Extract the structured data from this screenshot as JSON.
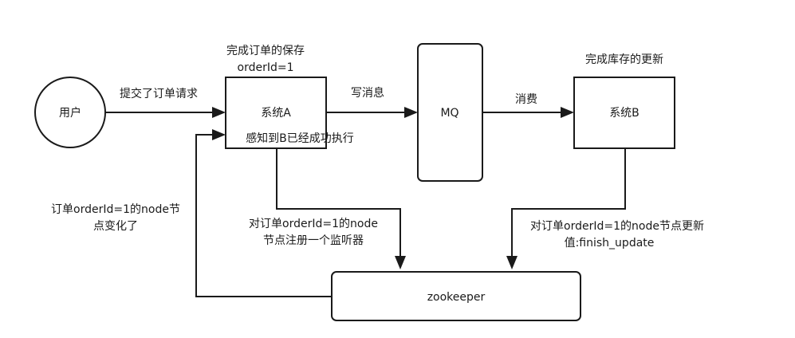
{
  "nodes": {
    "user": "用户",
    "system_a": "系统A",
    "mq": "MQ",
    "system_b": "系统B",
    "zookeeper": "zookeeper"
  },
  "labels": {
    "submit_order": "提交了订单请求",
    "save_order_line1": "完成订单的保存",
    "save_order_line2": "orderId=1",
    "write_message": "写消息",
    "consume": "消费",
    "inventory_done": "完成库存的更新",
    "sensed_b_done": "感知到B已经成功执行",
    "node_changed_line1": "订单orderId=1的node节",
    "node_changed_line2": "点变化了",
    "register_listener_line1": "对订单orderId=1的node",
    "register_listener_line2": "节点注册一个监听器",
    "update_node_line1": "对订单orderId=1的node节点更新",
    "update_node_line2": "值:finish_update"
  },
  "colors": {
    "stroke": "#1a1a1a",
    "background": "#ffffff"
  }
}
